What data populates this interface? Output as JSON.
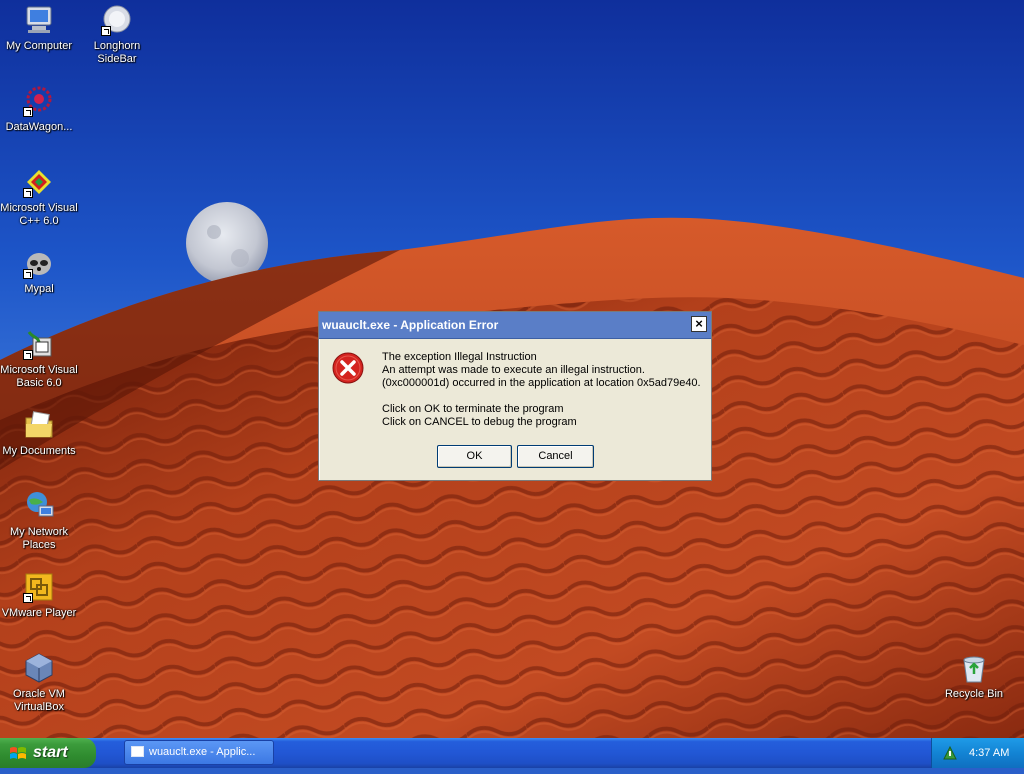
{
  "desktop": {
    "icons": [
      {
        "label": "My Computer",
        "icon": "my-computer-icon"
      },
      {
        "label": "Longhorn SideBar",
        "icon": "longhorn-sidebar-icon"
      },
      {
        "label": "DataWagon...",
        "icon": "datawagon-icon"
      },
      {
        "label": "Microsoft Visual C++ 6.0",
        "icon": "visual-cpp-icon"
      },
      {
        "label": "Mypal",
        "icon": "mypal-icon"
      },
      {
        "label": "Microsoft Visual Basic 6.0",
        "icon": "visual-basic-icon"
      },
      {
        "label": "My Documents",
        "icon": "my-documents-icon"
      },
      {
        "label": "My Network Places",
        "icon": "network-places-icon"
      },
      {
        "label": "VMware Player",
        "icon": "vmware-player-icon"
      },
      {
        "label": "Oracle VM VirtualBox",
        "icon": "virtualbox-icon"
      },
      {
        "label": "Recycle Bin",
        "icon": "recycle-bin-icon"
      }
    ]
  },
  "dialog": {
    "title": "wuauclt.exe - Application Error",
    "close_label": "×",
    "message_lines": [
      "The exception Illegal Instruction",
      "An attempt was made to execute an illegal instruction.",
      " (0xc000001d) occurred in the application at location 0x5ad79e40.",
      "",
      "Click on OK to terminate the program",
      "Click on CANCEL to debug the program"
    ],
    "ok_label": "OK",
    "cancel_label": "Cancel"
  },
  "taskbar": {
    "start_label": "start",
    "task_label": "wuauclt.exe - Applic...",
    "clock": "4:37 AM"
  },
  "colors": {
    "sky": "#1b47b8",
    "dune": "#b8381a",
    "taskbar": "#245edc",
    "start": "#3c9c3c",
    "dialog_title": "#5a7ec7",
    "error": "#d4231f"
  }
}
